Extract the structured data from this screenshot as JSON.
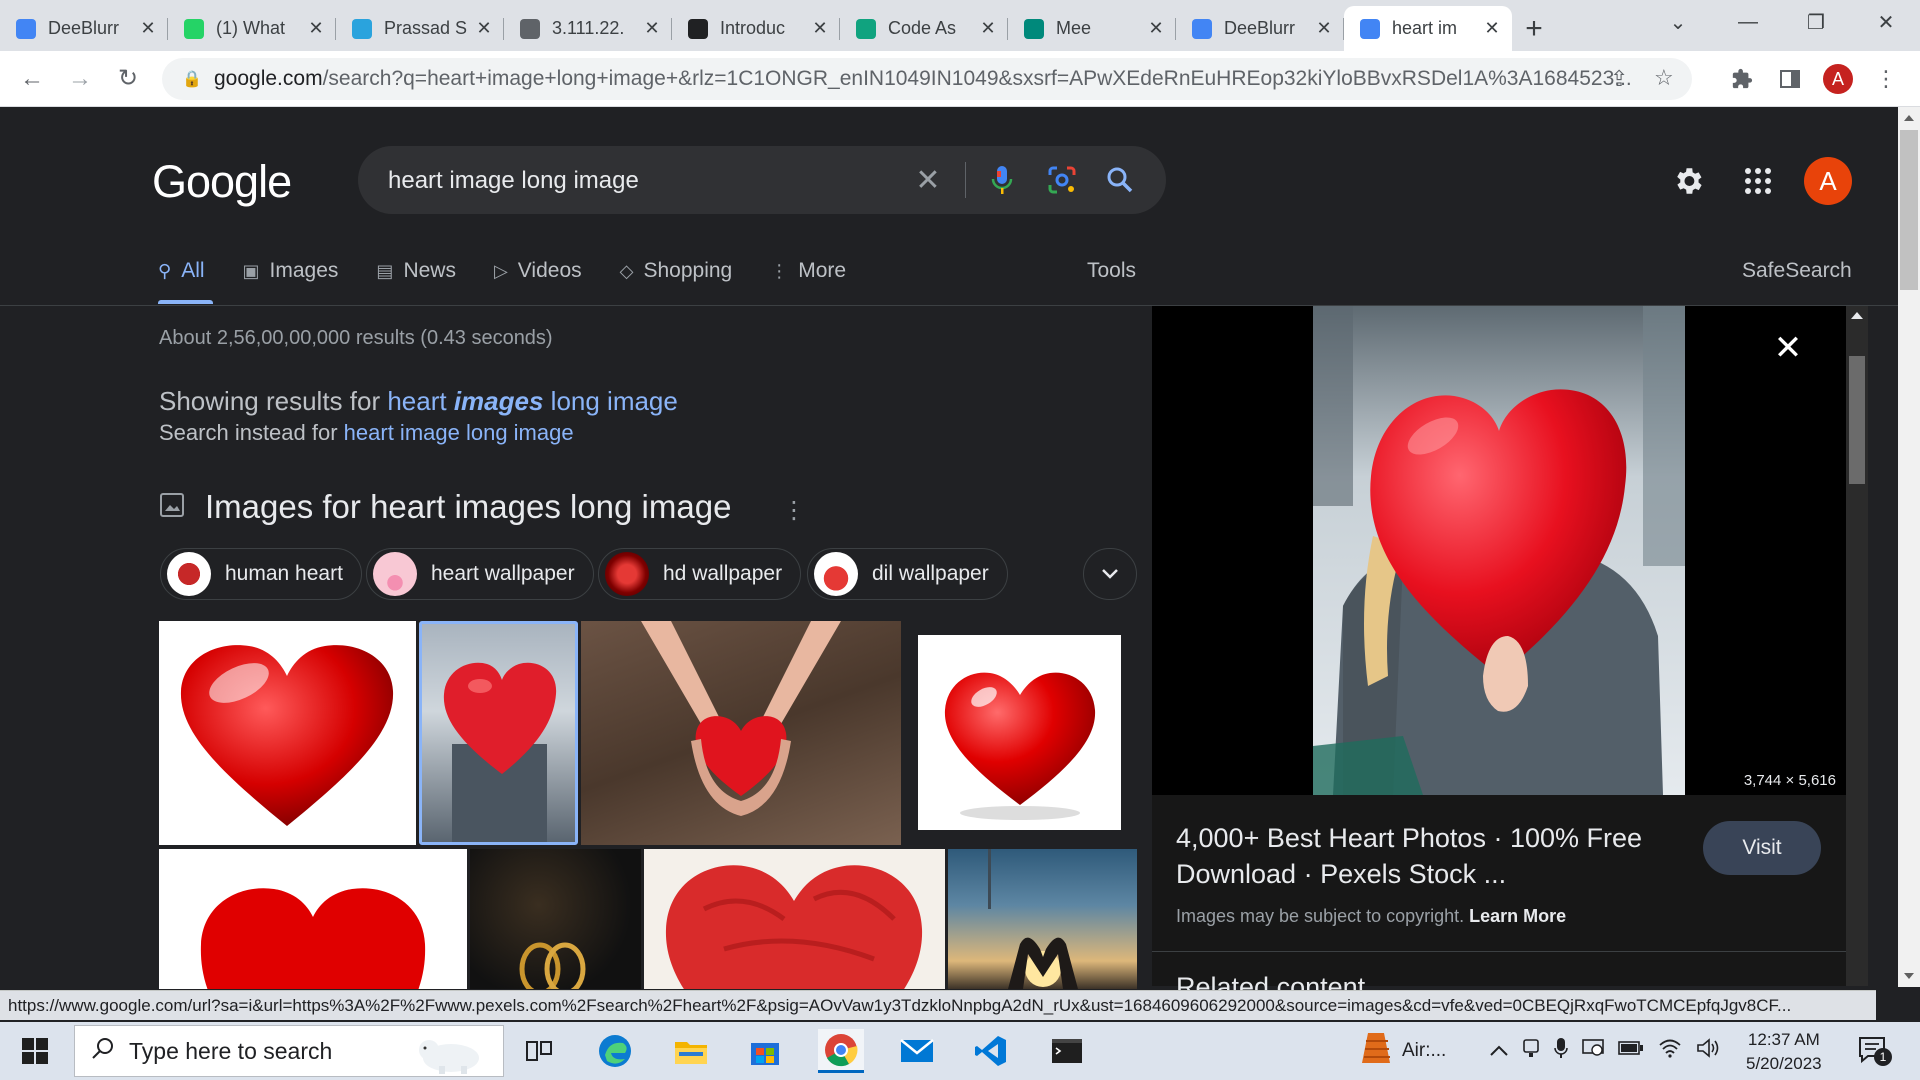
{
  "browser": {
    "tabs": [
      {
        "title": "DeeBlurr",
        "icon": "doc-icon",
        "color": "#4285f4"
      },
      {
        "title": "(1) What",
        "icon": "whatsapp-icon",
        "color": "#25d366"
      },
      {
        "title": "Prassad S",
        "icon": "telegram-icon",
        "color": "#2aa3dd"
      },
      {
        "title": "3.111.22.",
        "icon": "globe-icon",
        "color": "#5f6368"
      },
      {
        "title": "Introduc",
        "icon": "openai-icon",
        "color": "#202123"
      },
      {
        "title": "Code As",
        "icon": "openai-icon",
        "color": "#10a37f"
      },
      {
        "title": "Mee",
        "icon": "meet-icon",
        "color": "#00897b"
      },
      {
        "title": "DeeBlurr",
        "icon": "doc-icon",
        "color": "#4285f4"
      },
      {
        "title": "heart im",
        "icon": "google-icon",
        "color": "#4285f4",
        "active": true
      }
    ],
    "url_domain": "google.com",
    "url_rest": "/search?q=heart+image+long+image+&rlz=1C1ONGR_enIN1049IN1049&sxsrf=APwXEdeRnEuHREop32kiYloBBvxRSDel1A%3A1684523...",
    "profile_initial": "A"
  },
  "google": {
    "logo": "Google",
    "query": "heart image long image",
    "avatar_initial": "A",
    "nav_tabs": [
      {
        "label": "All",
        "icon": "search-icon"
      },
      {
        "label": "Images",
        "icon": "image-icon"
      },
      {
        "label": "News",
        "icon": "news-icon"
      },
      {
        "label": "Videos",
        "icon": "video-icon"
      },
      {
        "label": "Shopping",
        "icon": "tag-icon"
      },
      {
        "label": "More",
        "icon": "more-vert-icon"
      }
    ],
    "tools": "Tools",
    "safesearch": "SafeSearch"
  },
  "results": {
    "stats": "About 2,56,00,00,000 results (0.43 seconds)",
    "showing_prefix": "Showing results for ",
    "showing_q1": "heart ",
    "showing_q2": "images",
    "showing_q3": " long image",
    "instead_prefix": "Search instead for ",
    "instead_link": "heart image long image",
    "images_title": "Images for heart images long image",
    "chips": [
      "human heart",
      "heart wallpaper",
      "hd wallpaper",
      "dil wallpaper"
    ]
  },
  "preview": {
    "dimensions": "3,744 × 5,616",
    "title": "4,000+ Best Heart Photos · 100% Free Download · Pexels Stock ...",
    "visit": "Visit",
    "copyright_prefix": "Images may be subject to copyright. ",
    "learn_more": "Learn More",
    "related": "Related content"
  },
  "status_url": "https://www.google.com/url?sa=i&url=https%3A%2F%2Fwww.pexels.com%2Fsearch%2Fheart%2F&psig=AOvVaw1y3TdzkloNnpbgA2dN_rUx&ust=1684609606292000&source=images&cd=vfe&ved=0CBEQjRxqFwoTCMCEpfqJgv8CF...",
  "taskbar": {
    "search_placeholder": "Type here to search",
    "weather_label": "Air:...",
    "time": "12:37 AM",
    "date": "5/20/2023",
    "notification_count": "1"
  }
}
